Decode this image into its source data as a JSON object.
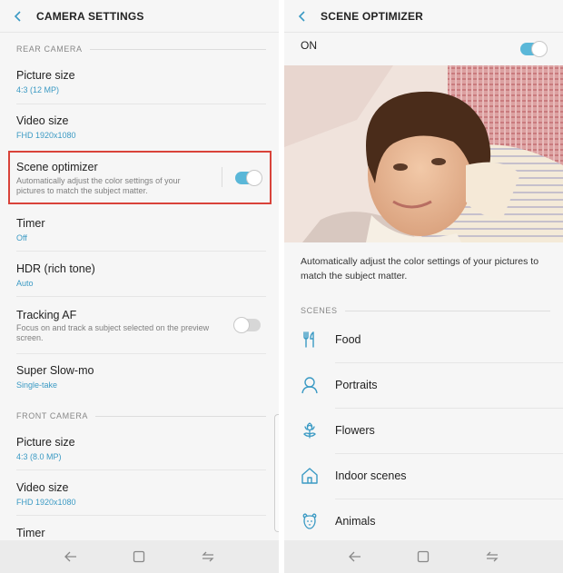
{
  "left": {
    "title": "CAMERA SETTINGS",
    "rear_section": "REAR CAMERA",
    "front_section": "FRONT CAMERA",
    "rear_items": [
      {
        "title": "Picture size",
        "sub": "4:3 (12 MP)"
      },
      {
        "title": "Video size",
        "sub": "FHD 1920x1080"
      },
      {
        "title": "Scene optimizer",
        "desc": "Automatically adjust the color settings of your pictures to match the subject matter.",
        "toggle": true
      },
      {
        "title": "Timer",
        "sub": "Off"
      },
      {
        "title": "HDR (rich tone)",
        "sub": "Auto"
      },
      {
        "title": "Tracking AF",
        "desc": "Focus on and track a subject selected on the preview screen.",
        "toggle": false
      },
      {
        "title": "Super Slow-mo",
        "sub": "Single-take"
      }
    ],
    "front_items": [
      {
        "title": "Picture size",
        "sub": "4:3 (8.0 MP)"
      },
      {
        "title": "Video size",
        "sub": "FHD 1920x1080"
      },
      {
        "title": "Timer",
        "sub": ""
      }
    ]
  },
  "right": {
    "title": "SCENE OPTIMIZER",
    "on_label": "ON",
    "on_state": true,
    "description": "Automatically adjust the color settings of your pictures to match the subject matter.",
    "scenes_section": "SCENES",
    "scenes": [
      {
        "label": "Food",
        "icon": "fork-knife-icon"
      },
      {
        "label": "Portraits",
        "icon": "person-icon"
      },
      {
        "label": "Flowers",
        "icon": "flower-icon"
      },
      {
        "label": "Indoor scenes",
        "icon": "house-icon"
      },
      {
        "label": "Animals",
        "icon": "dog-icon"
      }
    ]
  },
  "colors": {
    "accent": "#3b9ac4",
    "toggle_on": "#5ab7d8",
    "highlight": "#d9433a"
  }
}
